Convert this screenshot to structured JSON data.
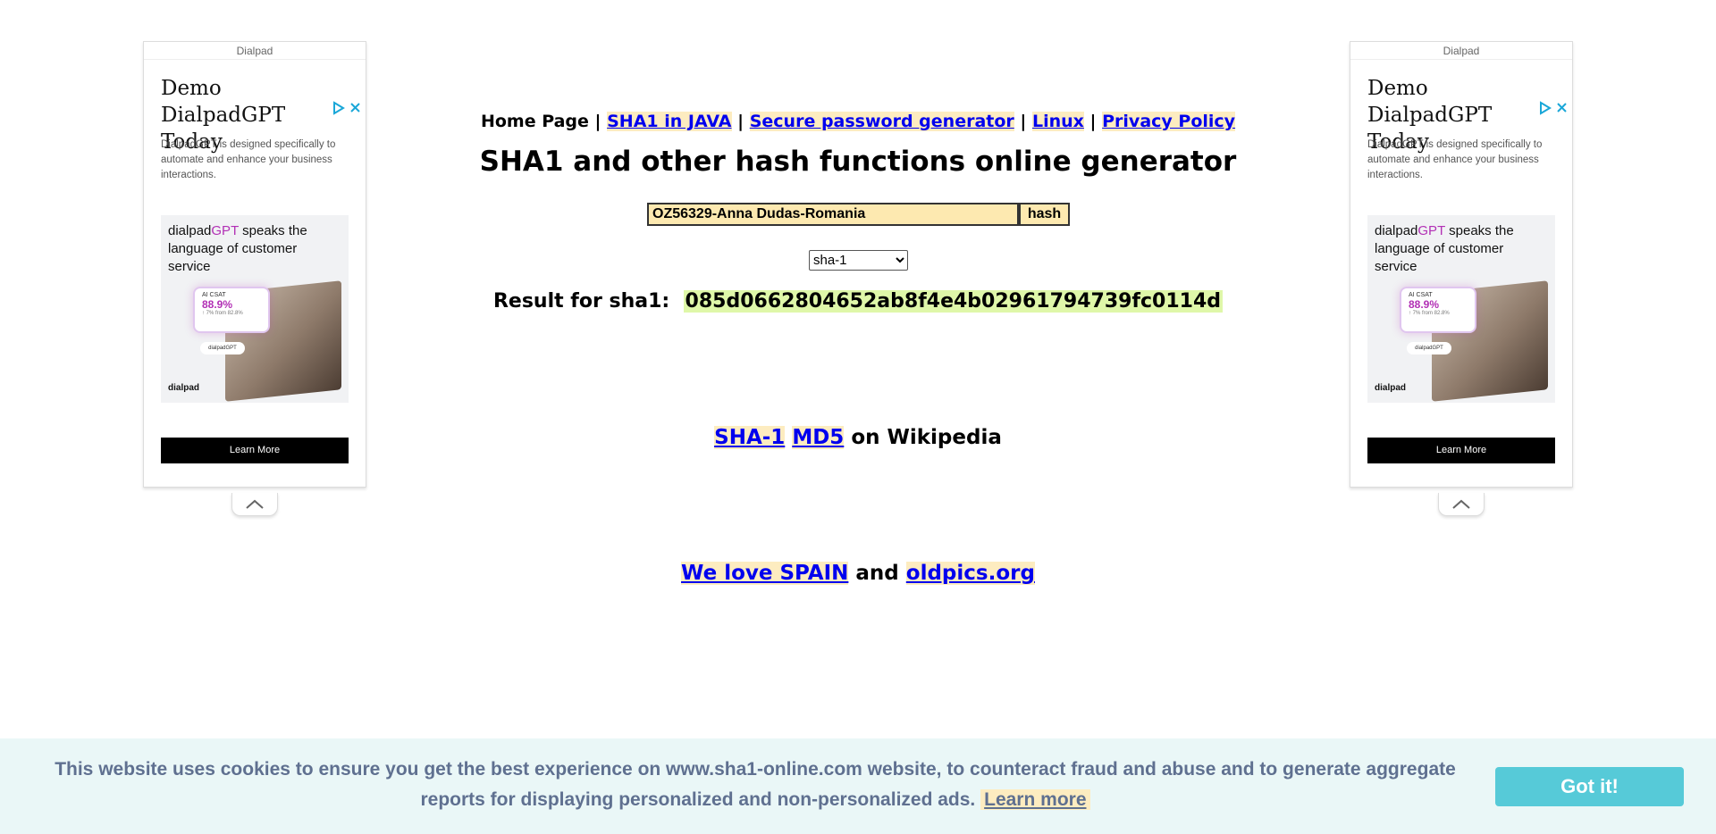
{
  "ads": {
    "sponsor": "Dialpad",
    "headline": "Demo\nDialpadGPT Today",
    "description": "DialpadGPT is designed specifically to automate and enhance your business interactions.",
    "card_text_prefix": "dialpad",
    "card_text_accent": "GPT",
    "card_text_suffix": " speaks the language of customer service",
    "stat_label": "AI CSAT",
    "stat_value": "88.9%",
    "stat_sub": "↑ 7% from 82.8%",
    "mini_badge": "dialpadGPT",
    "logo": "dialpad",
    "cta": "Learn More",
    "choices_icon": "adchoices-icon",
    "close_icon": "close-icon",
    "collapse_icon": "chevron-up-icon"
  },
  "nav": {
    "home": "Home Page",
    "separator": "|",
    "links": [
      "SHA1 in JAVA",
      "Secure password generator",
      "Linux",
      "Privacy Policy"
    ]
  },
  "title": "SHA1 and other hash functions online generator",
  "form": {
    "input_value": "OZ56329-Anna Dudas-Romania",
    "button_label": "hash",
    "algorithm": "sha-1"
  },
  "result": {
    "label": "Result for sha1:",
    "hash": "085d0662804652ab8f4e4b02961794739fc0114d"
  },
  "wiki": {
    "links": [
      "SHA-1",
      "MD5"
    ],
    "suffix": "on Wikipedia"
  },
  "love": {
    "link1": "We love SPAIN",
    "conjunction": "and",
    "link2": "oldpics.org"
  },
  "cookie": {
    "text": "This website uses cookies to ensure you get the best experience on www.sha1-online.com website, to counteract fraud and abuse and to generate aggregate reports for displaying personalized and non-personalized ads.",
    "learn_more": "Learn more",
    "button": "Got it!"
  },
  "colors": {
    "link": "#0000ee",
    "link_bg": "#fdecc0",
    "hash_bg": "#dff7a9",
    "cookie_bg": "#eaf7f7",
    "cookie_button": "#56cad8",
    "cookie_text": "#5f7090",
    "ad_accent": "#b230b5"
  }
}
